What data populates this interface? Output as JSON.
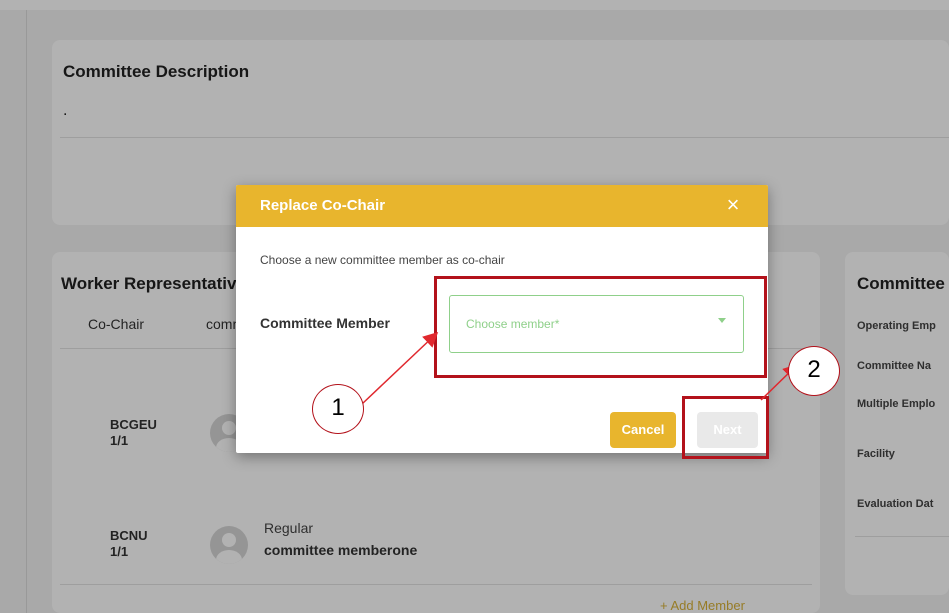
{
  "description_card": {
    "title": "Committee Description",
    "text": "."
  },
  "worker_card": {
    "title": "Worker Representatives",
    "columns": [
      "Co-Chair",
      "committee"
    ],
    "rows": [
      {
        "org": "BCGEU",
        "count": "1/1",
        "role": "",
        "name": ""
      },
      {
        "org": "BCNU",
        "count": "1/1",
        "role": "Regular",
        "name": "committee memberone"
      }
    ],
    "add_member": "+ Add Member"
  },
  "committee_card": {
    "title": "Committee",
    "fields": [
      "Operating Emp",
      "Committee Na",
      "Multiple Emplo",
      "Facility",
      "Evaluation Dat"
    ]
  },
  "modal": {
    "title": "Replace Co-Chair",
    "close_icon": "×",
    "hint": "Choose a new committee member as co-chair",
    "field_label": "Committee Member",
    "select_placeholder": "Choose member*",
    "cancel_label": "Cancel",
    "next_label": "Next"
  },
  "annotations": {
    "marker_1": "1",
    "marker_2": "2",
    "color": "#b3121b"
  },
  "colors": {
    "accent": "#e8b52d",
    "select_border": "#8fd08a"
  }
}
